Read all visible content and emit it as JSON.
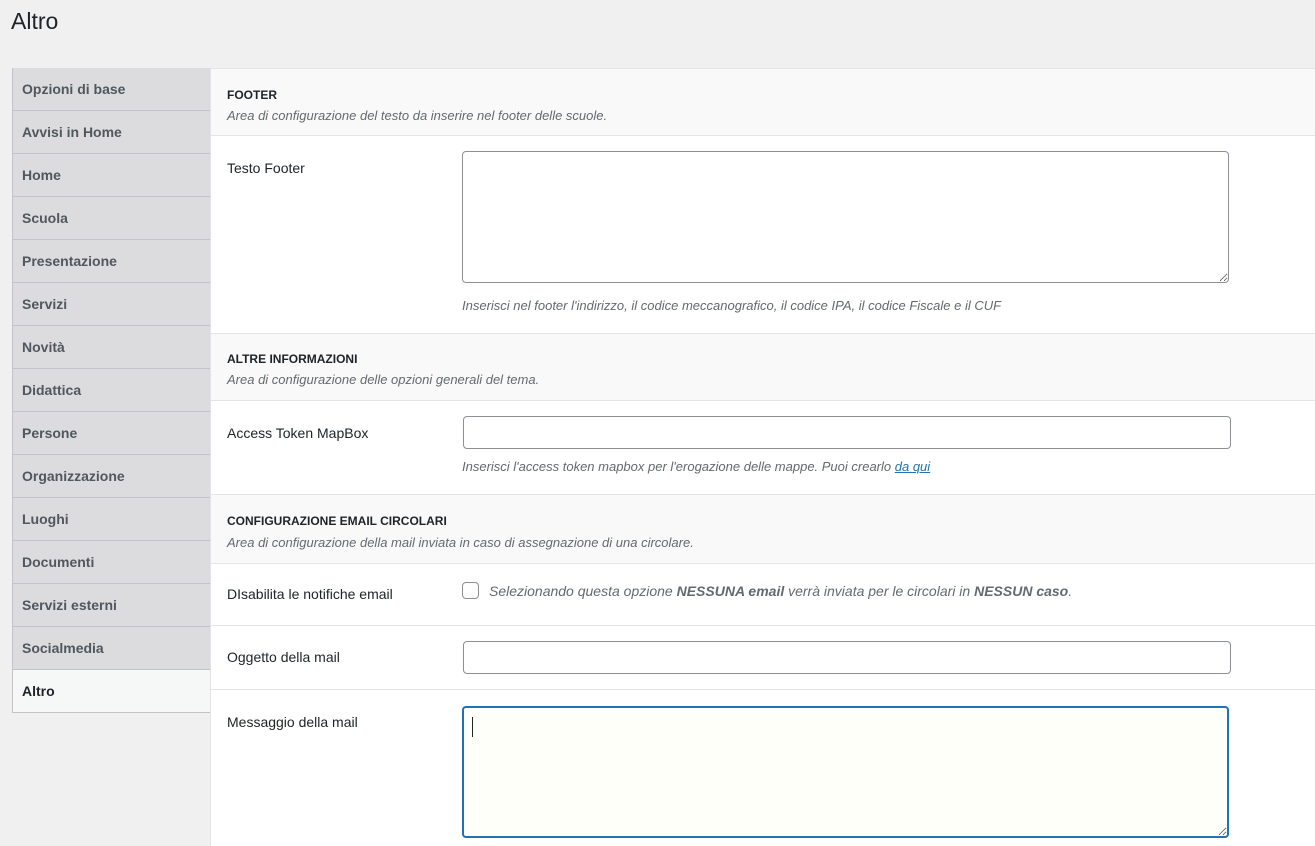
{
  "page": {
    "title": "Altro"
  },
  "sidebar": {
    "items": [
      {
        "label": "Opzioni di base"
      },
      {
        "label": "Avvisi in Home"
      },
      {
        "label": "Home"
      },
      {
        "label": "Scuola"
      },
      {
        "label": "Presentazione"
      },
      {
        "label": "Servizi"
      },
      {
        "label": "Novità"
      },
      {
        "label": "Didattica"
      },
      {
        "label": "Persone"
      },
      {
        "label": "Organizzazione"
      },
      {
        "label": "Luoghi"
      },
      {
        "label": "Documenti"
      },
      {
        "label": "Servizi esterni"
      },
      {
        "label": "Socialmedia"
      },
      {
        "label": "Altro",
        "active": true
      }
    ]
  },
  "footer": {
    "title": "FOOTER",
    "description": "Area di configurazione del testo da inserire nel footer delle scuole.",
    "testo_footer": {
      "label": "Testo Footer",
      "value": "",
      "help": "Inserisci nel footer l'indirizzo, il codice meccanografico, il codice IPA, il codice Fiscale e il CUF"
    }
  },
  "altre_informazioni": {
    "title": "ALTRE INFORMAZIONI",
    "description": "Area di configurazione delle opzioni generali del tema.",
    "mapbox": {
      "label": "Access Token MapBox",
      "value": "",
      "help": "Inserisci l'access token mapbox per l'erogazione delle mappe. Puoi crearlo ",
      "help_link": "da qui"
    }
  },
  "email_circolari": {
    "title": "CONFIGURAZIONE EMAIL CIRCOLARI",
    "description": "Area di configurazione della mail inviata in caso di assegnazione di una circolare.",
    "disabilita": {
      "label": "DIsabilita le notifiche email",
      "checked": false,
      "text_1": "Selezionando questa opzione ",
      "text_bold_1": "NESSUNA email",
      "text_2": " verrà inviata per le circolari in ",
      "text_bold_2": "NESSUN caso",
      "text_3": "."
    },
    "oggetto": {
      "label": "Oggetto della mail",
      "value": ""
    },
    "messaggio": {
      "label": "Messaggio della mail",
      "value": ""
    }
  },
  "colors": {
    "accent": "#2271b1",
    "tab_bg": "#dcdcde",
    "tab_active_bg": "#f6f7f7",
    "page_bg": "#f0f0f1"
  }
}
